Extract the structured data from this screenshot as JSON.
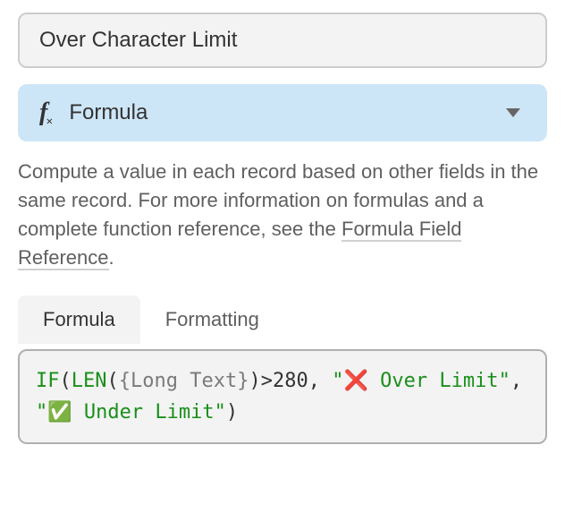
{
  "field_name": "Over Character Limit",
  "type_selector": {
    "icon_main": "f",
    "icon_sub": "×",
    "label": "Formula"
  },
  "description": {
    "text_before": "Compute a value in each record based on other fields in the same record. For more information on formulas and a complete function reference, see the ",
    "link_text": "Formula Field Reference",
    "text_after": "."
  },
  "tabs": {
    "formula": "Formula",
    "formatting": "Formatting"
  },
  "formula": {
    "fn_if": "IF",
    "lp1": "(",
    "fn_len": "LEN",
    "lp2": "(",
    "field_ref": "{Long Text}",
    "rp2": ")",
    "gt": ">",
    "num": "280",
    "comma1": ", ",
    "q1a": "\"",
    "emoji1": "❌",
    "str1": " Over Limit",
    "q1b": "\"",
    "comma2": ", ",
    "q2a": "\"",
    "emoji2": "✅",
    "str2": " Under Limit",
    "q2b": "\"",
    "rp1": ")"
  }
}
